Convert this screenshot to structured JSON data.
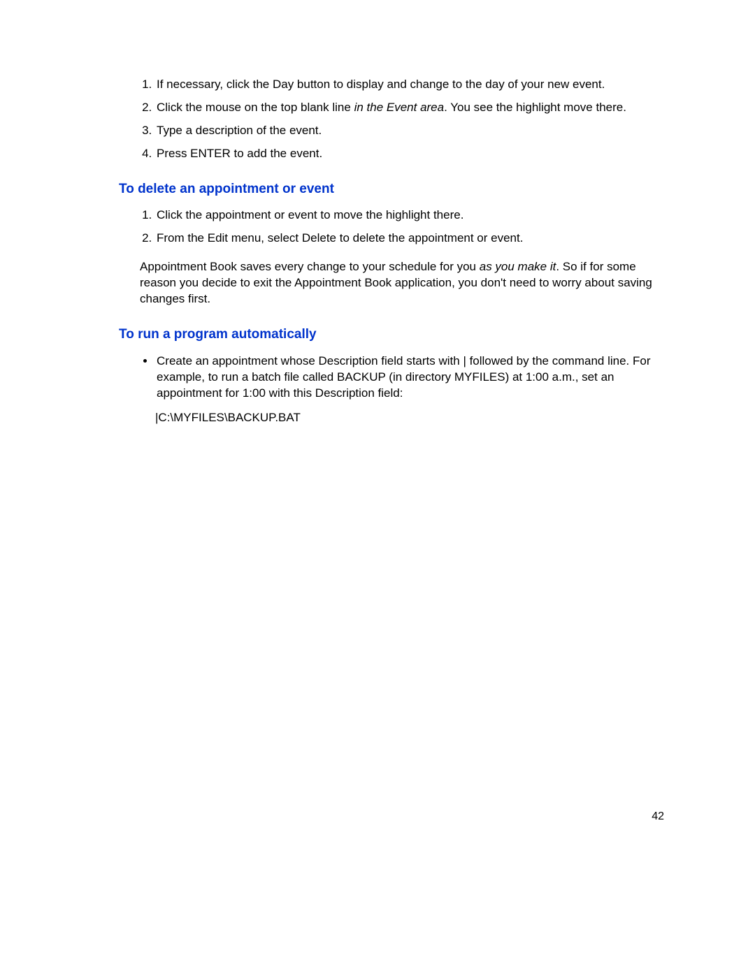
{
  "list1": {
    "item1_a": "If necessary, click the Day button to display and change to the day of your new event.",
    "item2_a": "Click the mouse on the top blank line ",
    "item2_em": "in the Event area",
    "item2_b": ". You see the highlight move there.",
    "item3": "Type a description of the event.",
    "item4": "Press ENTER to add the event."
  },
  "heading1": "To delete an appointment or event",
  "list2": {
    "item1": "Click the appointment or event to move the highlight there.",
    "item2": "From the Edit menu, select Delete to delete the appointment or event."
  },
  "para1_a": "Appointment Book saves every change to your schedule for you ",
  "para1_em": "as you make it",
  "para1_b": ". So if for some reason you decide to exit the Appointment Book application, you don't need to worry about saving changes first.",
  "heading2": "To run a program automatically",
  "list3": {
    "item1": "Create an appointment whose Description field starts with | followed by the command line. For example, to run a batch file called BACKUP (in directory MYFILES) at 1:00 a.m., set an appointment for 1:00 with this Description field:"
  },
  "code": "|C:\\MYFILES\\BACKUP.BAT",
  "pageNumber": "42"
}
